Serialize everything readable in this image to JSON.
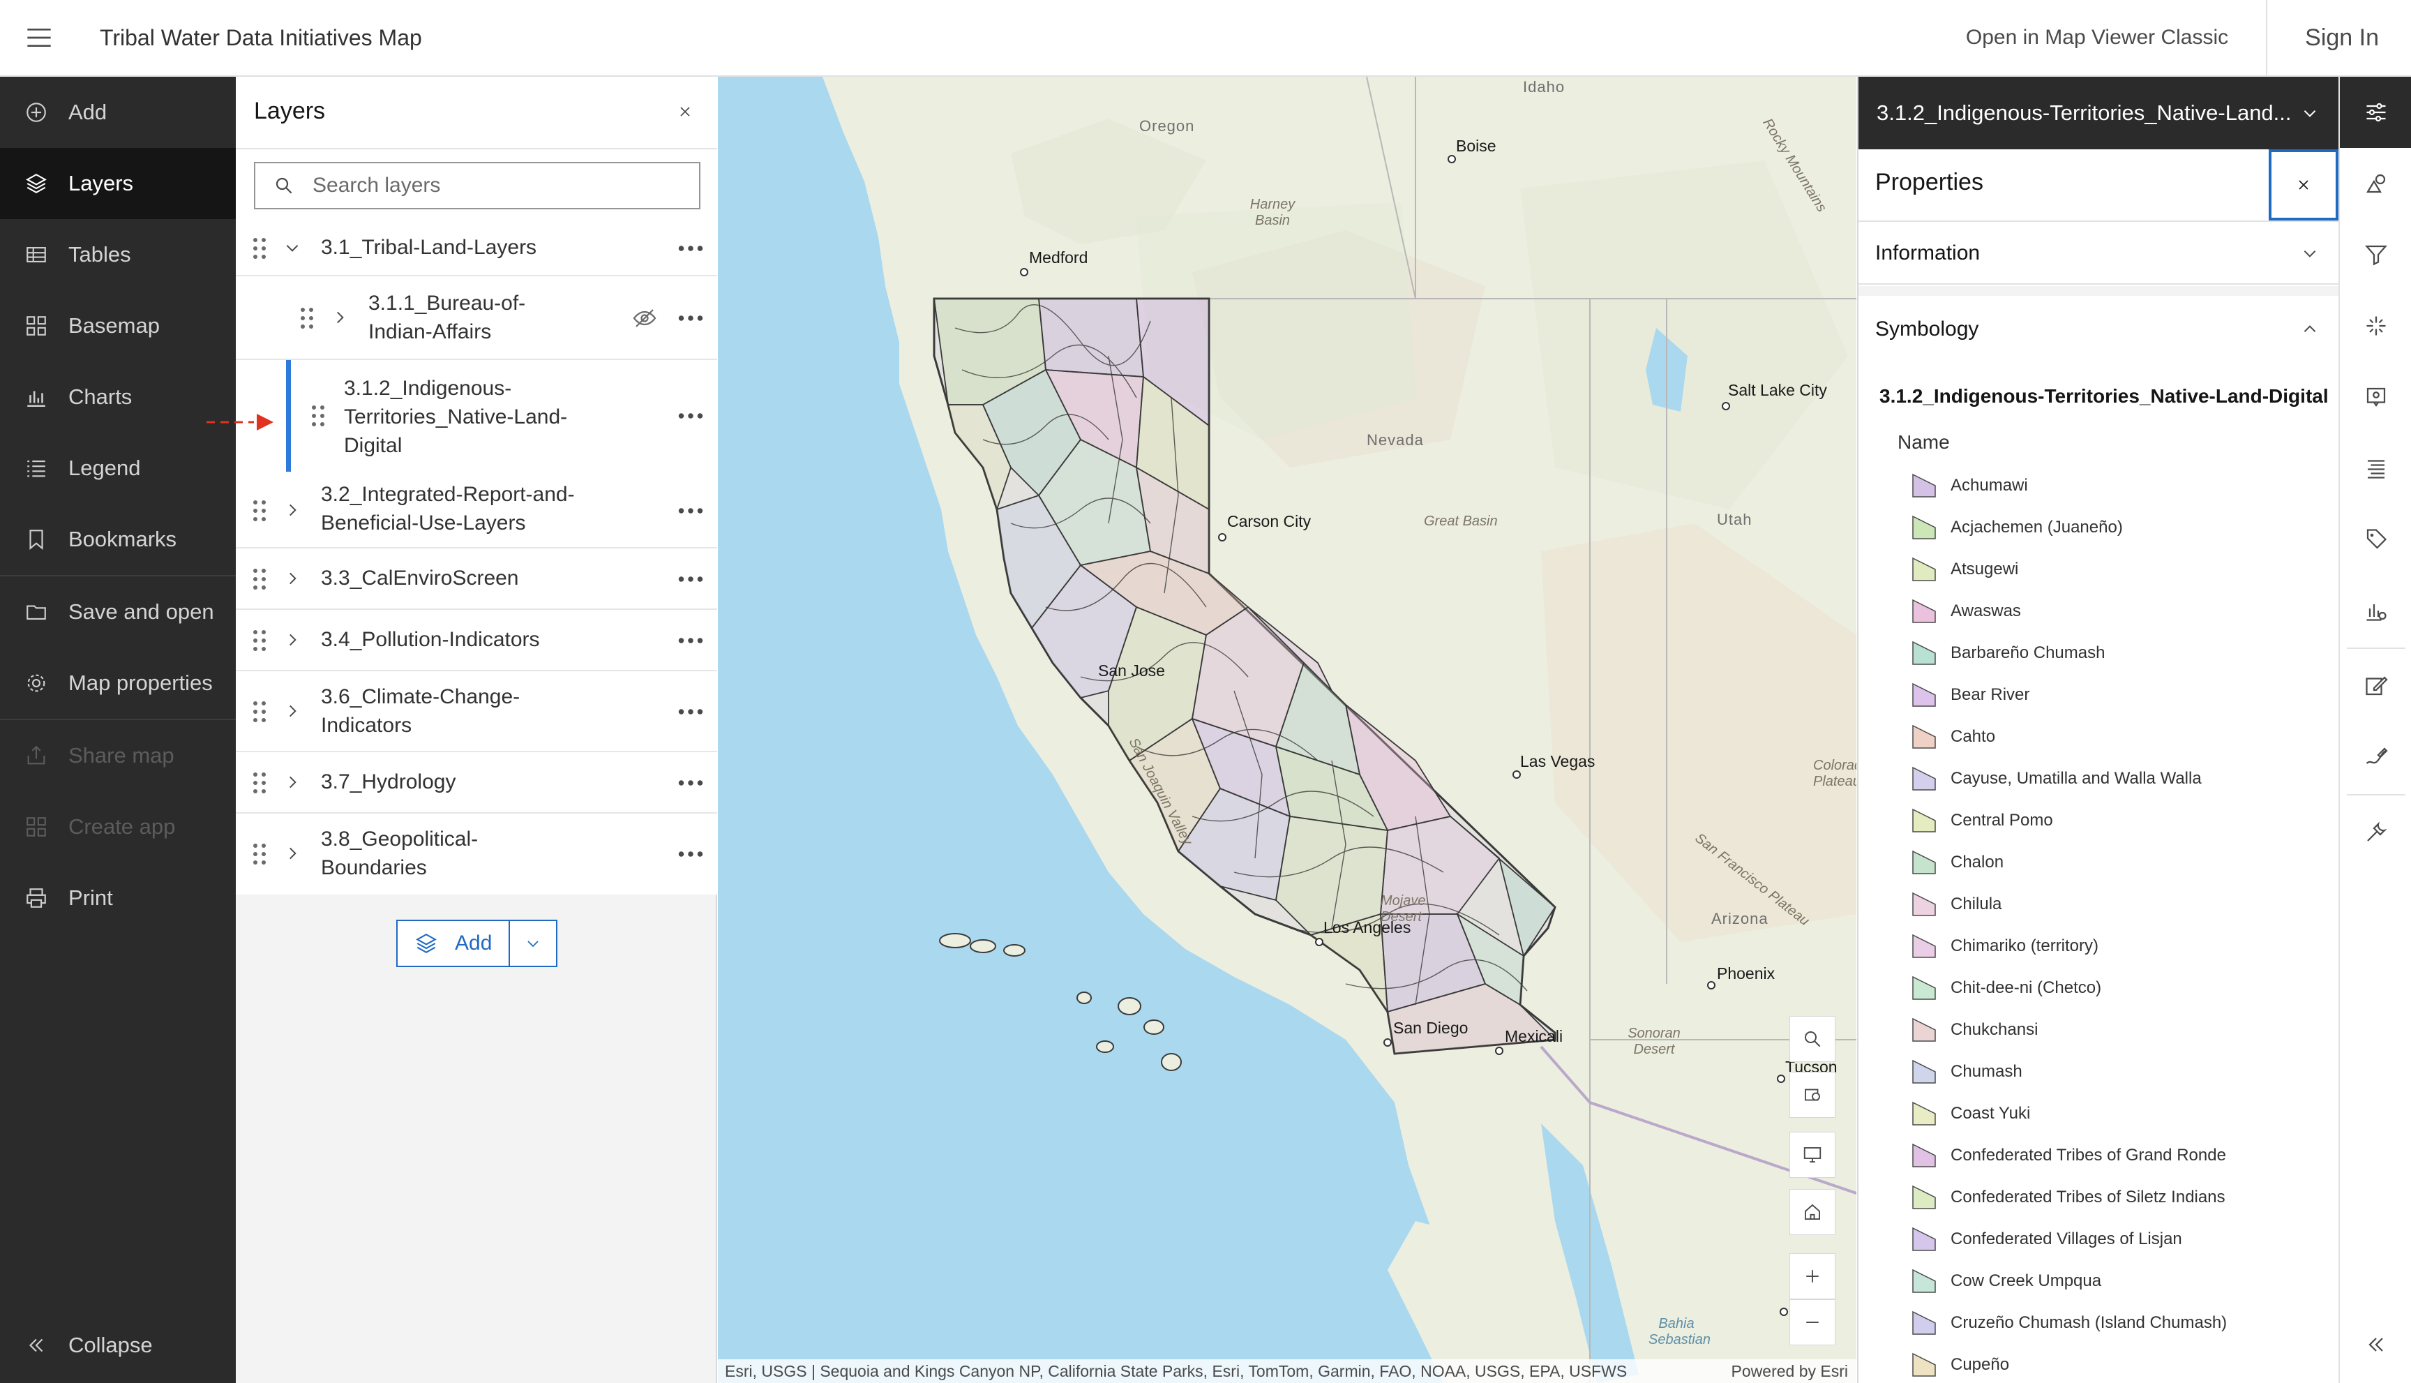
{
  "header": {
    "title": "Tribal Water Data Initiatives Map",
    "open_classic": "Open in Map Viewer Classic",
    "sign_in": "Sign In"
  },
  "nav": {
    "items": [
      {
        "label": "Add",
        "icon": "plus-circle-icon"
      },
      {
        "label": "Layers",
        "icon": "layers-icon"
      },
      {
        "label": "Tables",
        "icon": "table-icon"
      },
      {
        "label": "Basemap",
        "icon": "basemap-icon"
      },
      {
        "label": "Charts",
        "icon": "chart-icon"
      },
      {
        "label": "Legend",
        "icon": "legend-icon"
      },
      {
        "label": "Bookmarks",
        "icon": "bookmark-icon"
      },
      {
        "label": "Save and open",
        "icon": "folder-icon"
      },
      {
        "label": "Map properties",
        "icon": "gear-icon"
      },
      {
        "label": "Share map",
        "icon": "share-icon"
      },
      {
        "label": "Create app",
        "icon": "apps-icon"
      },
      {
        "label": "Print",
        "icon": "print-icon"
      }
    ],
    "collapse": "Collapse"
  },
  "layers": {
    "title": "Layers",
    "search_placeholder": "Search layers",
    "rows": [
      {
        "l1": "3.1_Tribal-Land-Layers"
      },
      {
        "l1": "3.1.1_Bureau-of-",
        "l2": "Indian-Affairs"
      },
      {
        "l1": "3.1.2_Indigenous-",
        "l2": "Territories_Native-Land-",
        "l3": "Digital"
      },
      {
        "l1": "3.2_Integrated-Report-and-",
        "l2": "Beneficial-Use-Layers"
      },
      {
        "l1": "3.3_CalEnviroScreen"
      },
      {
        "l1": "3.4_Pollution-Indicators"
      },
      {
        "l1": "3.6_Climate-Change-",
        "l2": "Indicators"
      },
      {
        "l1": "3.7_Hydrology"
      },
      {
        "l1": "3.8_Geopolitical-",
        "l2": "Boundaries"
      }
    ],
    "add_label": "Add"
  },
  "map": {
    "places": [
      "Idaho",
      "Oregon",
      "Boise",
      "Harney Basin",
      "Medford",
      "Salt Lake City",
      "Nevada",
      "Carson City",
      "Great Basin",
      "Utah",
      "San Jose",
      "San Joaquin Valley",
      "Las Vegas",
      "Colorado Plateau",
      "San Francisco Plateau",
      "Arizona",
      "Los Angeles",
      "Phoenix",
      "San Diego",
      "Mexicali",
      "Sonoran Desert",
      "Tucson",
      "Bahia Sebastian",
      "Rocky Mountains",
      "Mojave Desert"
    ],
    "attribution": "Esri, USGS | Sequoia and Kings Canyon NP, California State Parks, Esri, TomTom, Garmin, FAO, NOAA, USGS, EPA, USFWS",
    "powered": "Powered by Esri",
    "colors": {
      "ocean": "#a9d8ef",
      "land": "#eef0e2",
      "boundary": "#3a3a3a"
    }
  },
  "properties": {
    "layer_select": "3.1.2_Indigenous-Territories_Native-Land...",
    "title": "Properties",
    "information": "Information",
    "symbology": "Symbology",
    "sym_layer": "3.1.2_Indigenous-Territories_Native-Land-Digital",
    "field": "Name",
    "legend": [
      {
        "name": "Achumawi",
        "color": "#c9b3e0"
      },
      {
        "name": "Acjachemen (Juaneño)",
        "color": "#bfe0a6"
      },
      {
        "name": "Atsugewi",
        "color": "#d9e6b0"
      },
      {
        "name": "Awaswas",
        "color": "#e5b3d4"
      },
      {
        "name": "Barbareño Chumash",
        "color": "#a6d8c8"
      },
      {
        "name": "Bear River",
        "color": "#d4b3e6"
      },
      {
        "name": "Cahto",
        "color": "#ecc6b8"
      },
      {
        "name": "Cayuse, Umatilla and Walla Walla",
        "color": "#c9c3e8"
      },
      {
        "name": "Central Pomo",
        "color": "#dfe8b0"
      },
      {
        "name": "Chalon",
        "color": "#b8dcc2"
      },
      {
        "name": "Chilula",
        "color": "#e8c7d9"
      },
      {
        "name": "Chimariko (territory)",
        "color": "#e3c2df"
      },
      {
        "name": "Chit-dee-ni (Chetco)",
        "color": "#bde3c8"
      },
      {
        "name": "Chukchansi",
        "color": "#e6c9c9"
      },
      {
        "name": "Chumash",
        "color": "#c3cbe6"
      },
      {
        "name": "Coast Yuki",
        "color": "#e3e8b8"
      },
      {
        "name": "Confederated Tribes of Grand Ronde",
        "color": "#dab3de"
      },
      {
        "name": "Confederated Tribes of Siletz Indians",
        "color": "#d3e6b3"
      },
      {
        "name": "Confederated Villages of Lisjan",
        "color": "#cbb8e6"
      },
      {
        "name": "Cow Creek Umpqua",
        "color": "#b8e0cf"
      },
      {
        "name": "Cruzeño Chumash (Island Chumash)",
        "color": "#c6c2e8"
      },
      {
        "name": "Cupeño",
        "color": "#e8dcb3"
      }
    ]
  }
}
